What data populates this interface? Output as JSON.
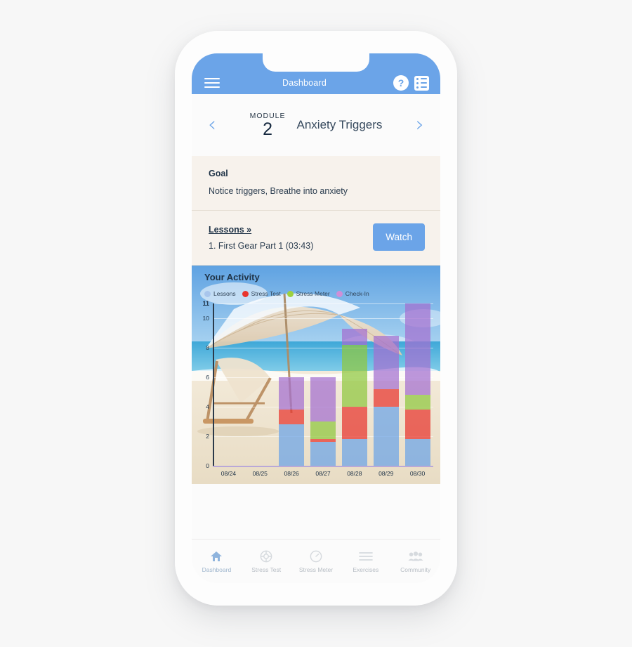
{
  "app": {
    "title": "Dashboard",
    "menu_icon": "hamburger-icon",
    "help_icon": "help-icon",
    "help_glyph": "?",
    "list_icon": "list-icon"
  },
  "module": {
    "prev_glyph": "‹",
    "next_glyph": "›",
    "label": "MODULE",
    "number": "2",
    "title": "Anxiety Triggers"
  },
  "goal": {
    "heading": "Goal",
    "text": "Notice triggers, Breathe into anxiety"
  },
  "lessons": {
    "link": "Lessons »",
    "item": "1. First Gear Part 1 (03:43)",
    "watch_label": "Watch"
  },
  "activity": {
    "title": "Your Activity"
  },
  "chart_data": {
    "type": "bar",
    "title": "Your Activity",
    "stacked": true,
    "xlabel": "",
    "ylabel": "",
    "ylim": [
      0,
      11
    ],
    "yticks": [
      "0",
      "2",
      "4",
      "6",
      "8",
      "10",
      "11"
    ],
    "ytick_values": [
      0,
      2,
      4,
      6,
      8,
      10,
      11
    ],
    "grid": true,
    "legend_position": "top-left",
    "categories": [
      "08/24",
      "08/25",
      "08/26",
      "08/27",
      "08/28",
      "08/29",
      "08/30"
    ],
    "series": [
      {
        "name": "Lessons",
        "color": "#6ba4e8",
        "values": [
          0,
          0,
          2.8,
          1.6,
          1.8,
          4.0,
          1.8
        ]
      },
      {
        "name": "Stress Test",
        "color": "#e8342e",
        "values": [
          0,
          0,
          1.0,
          0.2,
          2.2,
          1.2,
          2.0
        ]
      },
      {
        "name": "Stress Meter",
        "color": "#8fc73e",
        "values": [
          0,
          0,
          0.0,
          1.2,
          4.2,
          0.0,
          1.0
        ]
      },
      {
        "name": "Check-In",
        "color": "#a36fd0",
        "values": [
          0,
          0,
          2.2,
          3.0,
          1.1,
          3.6,
          6.2
        ]
      }
    ],
    "totals": [
      0,
      0,
      6.0,
      6.0,
      9.3,
      8.8,
      11.0
    ]
  },
  "bottom_nav": {
    "items": [
      {
        "label": "Dashboard",
        "icon": "home-icon",
        "active": true
      },
      {
        "label": "Stress Test",
        "icon": "lifebuoy-icon",
        "active": false
      },
      {
        "label": "Stress Meter",
        "icon": "gauge-icon",
        "active": false
      },
      {
        "label": "Exercises",
        "icon": "list-lines-icon",
        "active": false
      },
      {
        "label": "Community",
        "icon": "people-group-icon",
        "active": false
      }
    ]
  },
  "colors": {
    "brand_blue": "#6ba4e8",
    "card_beige": "#f7f2ec",
    "text_dark": "#1f3347"
  }
}
